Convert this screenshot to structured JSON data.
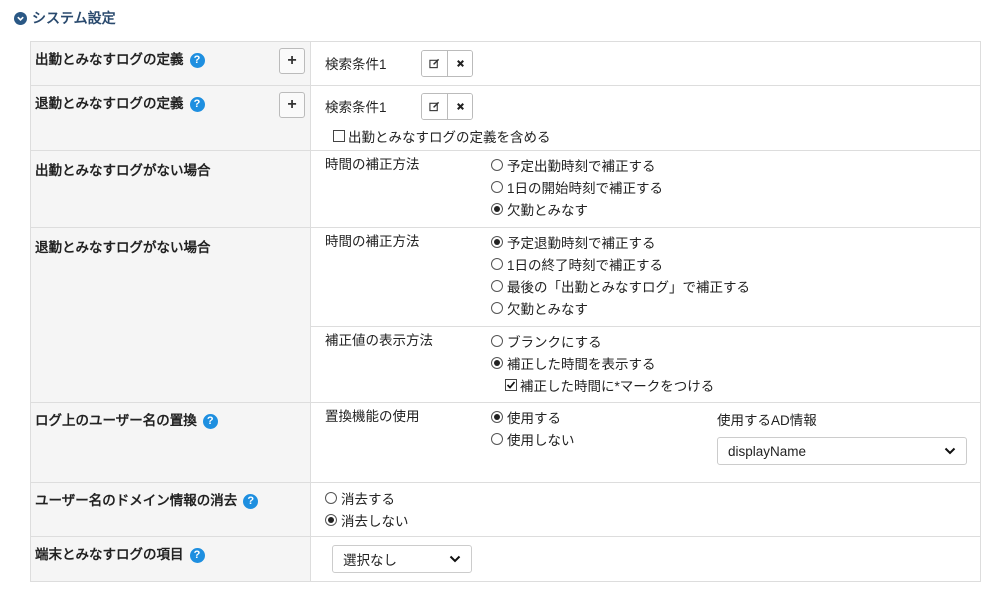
{
  "section": {
    "title": "システム設定",
    "icon": "chevron-down-icon"
  },
  "rows": {
    "checkin_def": {
      "label": "出勤とみなすログの定義",
      "condition": "検索条件1"
    },
    "checkout_def": {
      "label": "退勤とみなすログの定義",
      "condition": "検索条件1",
      "include_checkin": "出勤とみなすログの定義を含める"
    },
    "no_checkin": {
      "label": "出勤とみなすログがない場合",
      "sub_label": "時間の補正方法",
      "options": [
        "予定出勤時刻で補正する",
        "1日の開始時刻で補正する",
        "欠勤とみなす"
      ],
      "selected": 2
    },
    "no_checkout": {
      "label": "退勤とみなすログがない場合",
      "sub_label": "時間の補正方法",
      "options": [
        "予定退勤時刻で補正する",
        "1日の終了時刻で補正する",
        "最後の「出勤とみなすログ」で補正する",
        "欠勤とみなす"
      ],
      "selected": 0,
      "display_label": "補正値の表示方法",
      "display_options": [
        "ブランクにする",
        "補正した時間を表示する"
      ],
      "display_selected": 1,
      "mark_label": "補正した時間に*マークをつける",
      "mark_checked": true
    },
    "user_replace": {
      "label": "ログ上のユーザー名の置換",
      "sub_label": "置換機能の使用",
      "options": [
        "使用する",
        "使用しない"
      ],
      "selected": 0,
      "ad_label": "使用するAD情報",
      "ad_value": "displayName"
    },
    "domain_remove": {
      "label": "ユーザー名のドメイン情報の消去",
      "options": [
        "消去する",
        "消去しない"
      ],
      "selected": 1
    },
    "terminal_item": {
      "label": "端末とみなすログの項目",
      "select_value": "選択なし"
    }
  },
  "help_glyph": "?",
  "add_glyph": "+"
}
